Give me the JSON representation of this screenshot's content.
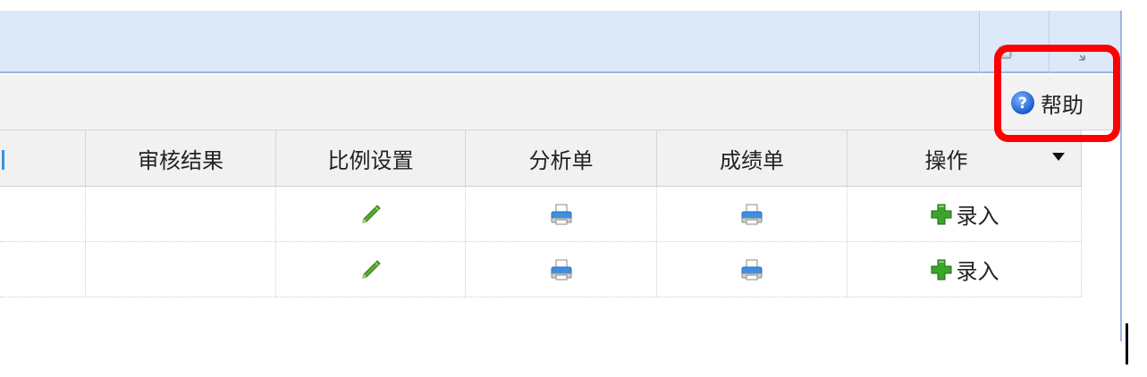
{
  "header": {
    "minimize_icon": "window-minimize-icon",
    "expand_icon": "expand-icon"
  },
  "toolbar": {
    "help_label": "帮助",
    "help_icon": "help-question-icon"
  },
  "grid": {
    "columns": [
      "",
      "审核结果",
      "比例设置",
      "分析单",
      "成绩单",
      "操作"
    ],
    "rows": [
      {
        "audit_result": "",
        "ratio_icon": "pencil-icon",
        "analysis_icon": "printer-icon",
        "score_icon": "printer-icon",
        "action_label": "录入",
        "action_icon": "green-plus-icon"
      },
      {
        "audit_result": "",
        "ratio_icon": "pencil-icon",
        "analysis_icon": "printer-icon",
        "score_icon": "printer-icon",
        "action_label": "录入",
        "action_icon": "green-plus-icon"
      }
    ]
  },
  "colors": {
    "header_bg": "#dde9f9",
    "highlight": "#ff0000",
    "toolbar_bg": "#f3f3f3",
    "grid_header_bg": "#f1f1f1"
  }
}
